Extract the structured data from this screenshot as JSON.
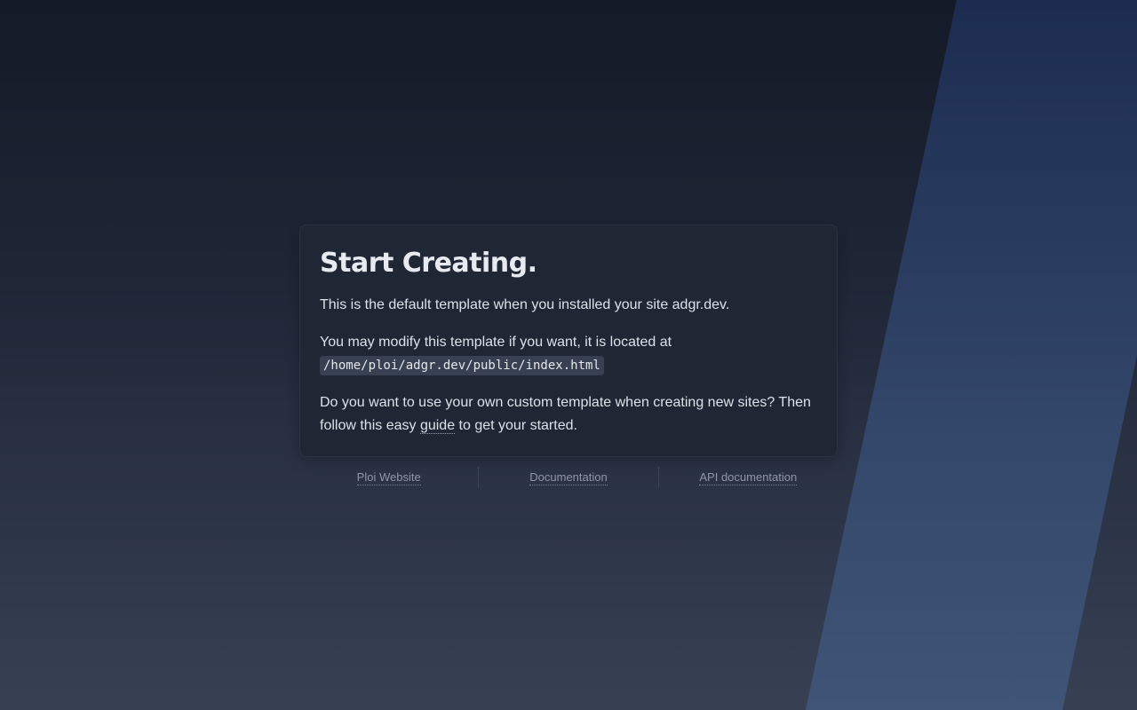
{
  "page": {
    "title": "Start Creating.",
    "intro": "This is the default template when you installed your site adgr.dev.",
    "modify_text": "You may modify this template if you want, it is located at",
    "template_path": "/home/ploi/adgr.dev/public/index.html",
    "custom_text_before": "Do you want to use your own custom template when creating new sites? Then follow this easy ",
    "guide_link": "guide",
    "custom_text_after": " to get your started."
  },
  "footer": {
    "links": [
      {
        "label": "Ploi Website"
      },
      {
        "label": "Documentation"
      },
      {
        "label": "API documentation"
      }
    ]
  },
  "colors": {
    "background_top": "#141a27",
    "background_bottom": "#374153",
    "card": "#1f2735",
    "stripe": "#2f4570",
    "code_background": "#374151"
  }
}
